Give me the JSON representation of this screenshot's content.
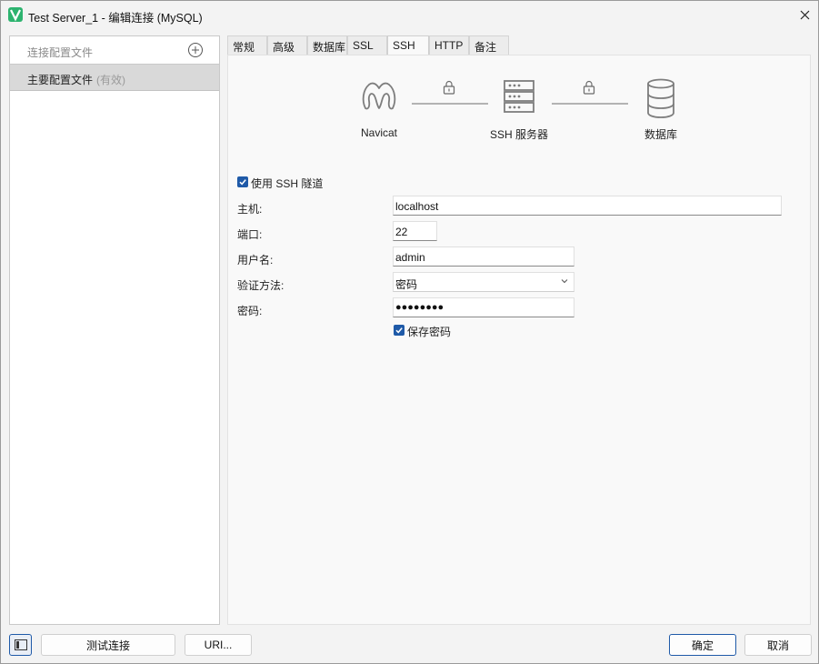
{
  "window": {
    "title": "Test Server_1 - 编辑连接 (MySQL)",
    "app_icon": "navicat-logo-icon",
    "close_icon": "close-icon"
  },
  "sidebar": {
    "header_label": "连接配置文件",
    "add_icon": "plus-circle-icon",
    "profiles": [
      {
        "label": "主要配置文件",
        "status": "(有效)",
        "selected": true
      }
    ]
  },
  "tabs": [
    {
      "label": "常规",
      "active": false
    },
    {
      "label": "高级",
      "active": false
    },
    {
      "label": "数据库",
      "active": false
    },
    {
      "label": "SSL",
      "active": false
    },
    {
      "label": "SSH",
      "active": true
    },
    {
      "label": "HTTP",
      "active": false
    },
    {
      "label": "备注",
      "active": false
    }
  ],
  "diagram": {
    "client_label": "Navicat",
    "server_label": "SSH 服务器",
    "database_label": "数据库",
    "client_icon": "navicat-logo-icon",
    "server_icon": "server-icon",
    "database_icon": "database-icon",
    "lock_icon": "lock-icon"
  },
  "ssh_form": {
    "use_tunnel_label": "使用 SSH 隧道",
    "use_tunnel_checked": true,
    "host_label": "主机:",
    "host_value": "localhost",
    "port_label": "端口:",
    "port_value": "22",
    "username_label": "用户名:",
    "username_value": "admin",
    "auth_label": "验证方法:",
    "auth_value": "密码",
    "password_label": "密码:",
    "password_value": "●●●●●●●●",
    "save_password_label": "保存密码",
    "save_password_checked": true
  },
  "footer": {
    "toggle_sidebar_icon": "sidebar-toggle-icon",
    "test_button": "测试连接",
    "uri_button": "URI...",
    "ok_button": "确定",
    "cancel_button": "取消"
  },
  "colors": {
    "accent": "#1f5aa8",
    "window_bg": "#f3f3f3",
    "selected_row": "#d9d9d9"
  }
}
